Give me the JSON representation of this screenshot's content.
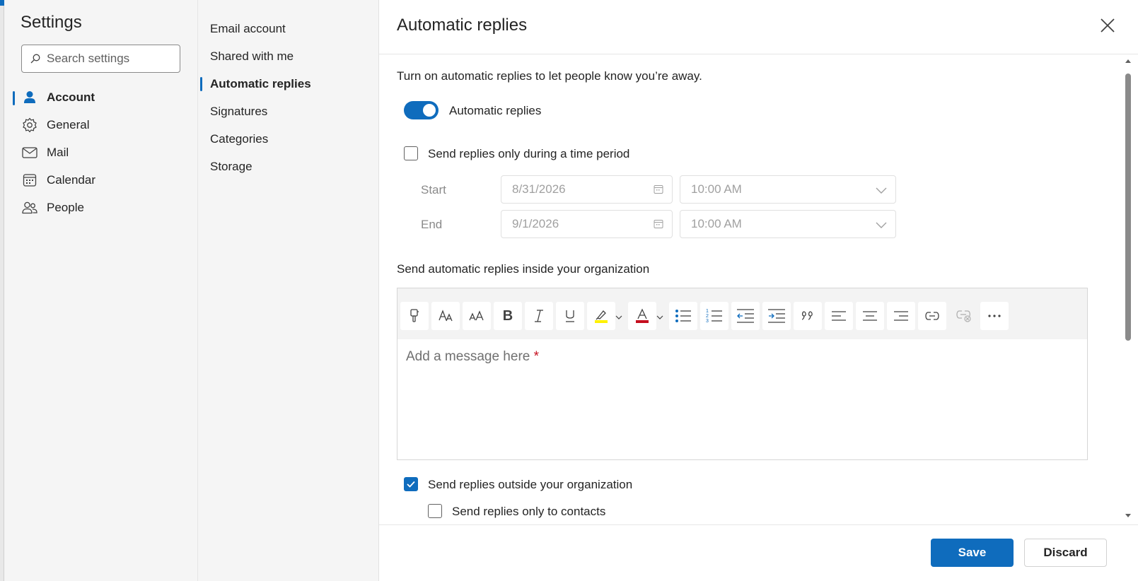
{
  "settings": {
    "title": "Settings",
    "search_placeholder": "Search settings"
  },
  "nav": {
    "items": [
      {
        "label": "Account",
        "icon": "person-icon",
        "active": true
      },
      {
        "label": "General",
        "icon": "gear-icon",
        "active": false
      },
      {
        "label": "Mail",
        "icon": "mail-icon",
        "active": false
      },
      {
        "label": "Calendar",
        "icon": "calendar-icon",
        "active": false
      },
      {
        "label": "People",
        "icon": "people-icon",
        "active": false
      }
    ]
  },
  "subnav": {
    "items": [
      {
        "label": "Email account",
        "active": false
      },
      {
        "label": "Shared with me",
        "active": false
      },
      {
        "label": "Automatic replies",
        "active": true
      },
      {
        "label": "Signatures",
        "active": false
      },
      {
        "label": "Categories",
        "active": false
      },
      {
        "label": "Storage",
        "active": false
      }
    ]
  },
  "main": {
    "title": "Automatic replies",
    "description": "Turn on automatic replies to let people know you’re away.",
    "toggle_label": "Automatic replies",
    "toggle_on": true,
    "time_period_label": "Send replies only during a time period",
    "time_period_checked": false,
    "start_label": "Start",
    "start_date": "8/31/2026",
    "start_time": "10:00 AM",
    "end_label": "End",
    "end_date": "9/1/2026",
    "end_time": "10:00 AM",
    "inside_label": "Send automatic replies inside your organization",
    "message_placeholder": "Add a message here",
    "required_marker": "*",
    "outside_label": "Send replies outside your organization",
    "outside_checked": true,
    "contacts_only_label": "Send replies only to contacts",
    "contacts_only_checked": false
  },
  "toolbar": {
    "buttons": [
      "format-painter-icon",
      "font-icon",
      "font-size-icon",
      "bold-icon",
      "italic-icon",
      "underline-icon",
      "highlight-icon",
      "font-color-icon",
      "bullets-icon",
      "numbering-icon",
      "decrease-indent-icon",
      "increase-indent-icon",
      "quote-icon",
      "align-left-icon",
      "align-center-icon",
      "align-right-icon",
      "link-icon",
      "remove-link-icon",
      "more-icon"
    ],
    "highlight_color": "#fff100",
    "font_color": "#c50f1f"
  },
  "footer": {
    "save_label": "Save",
    "discard_label": "Discard"
  },
  "colors": {
    "accent": "#0f6cbd"
  }
}
